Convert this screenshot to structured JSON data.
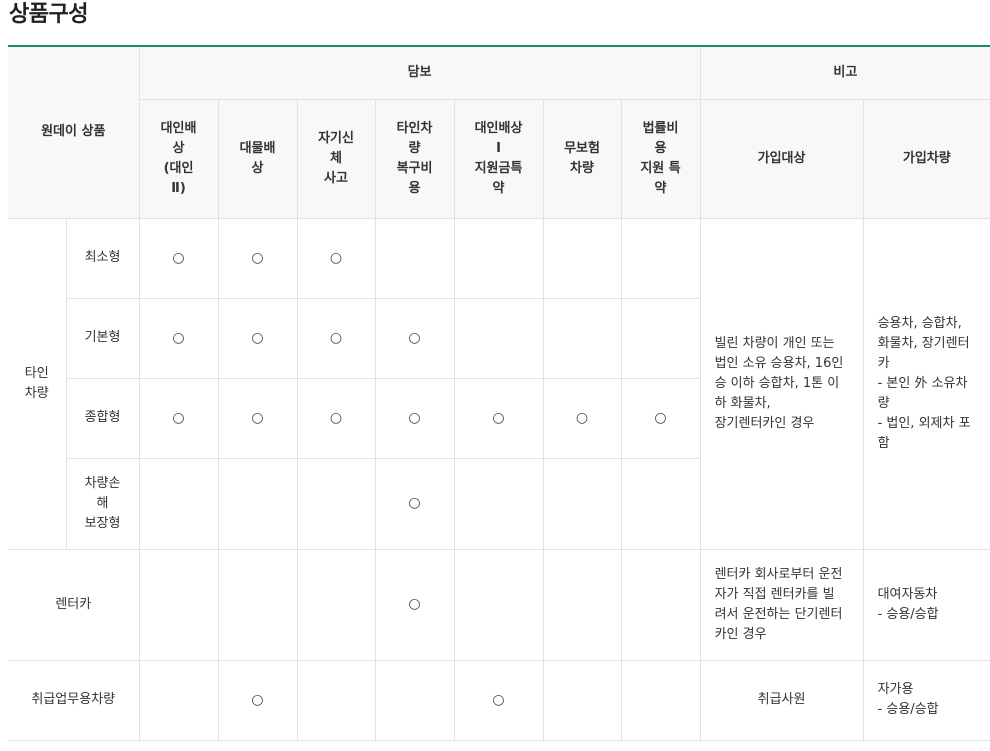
{
  "page": {
    "title": "상품구성"
  },
  "header": {
    "product_col": "원데이 상품",
    "coverage_group": "담보",
    "remarks_group": "비고",
    "coverage_items": [
      "대인배\n상\n(대인\nⅡ)",
      "대물배\n상",
      "자기신\n체\n사고",
      "타인차\n량\n복구비\n용",
      "대인배상\nⅠ\n지원금특\n약",
      "무보험\n차량",
      "법률비\n용\n지원 특\n약"
    ],
    "remark_items": [
      "가입대상",
      "가입차량"
    ]
  },
  "mark_symbol": "○",
  "groups": {
    "other_car": "타인\n차량"
  },
  "rows": {
    "minimum": {
      "label": "최소형"
    },
    "basic": {
      "label": "기본형"
    },
    "comprehensive": {
      "label": "종합형"
    },
    "damage": {
      "label": "차량손\n해\n보장형"
    },
    "rental": {
      "label": "렌터카",
      "target": "렌터카 회사로부터 운전\n자가 직접 렌터카를 빌\n려서 운전하는 단기렌터\n카인 경우",
      "vehicle": "대여자동차\n- 승용/승합"
    },
    "business": {
      "label": "취급업무용차량",
      "target": "취급사원",
      "vehicle": "자가용\n- 승용/승합"
    }
  },
  "other_car_remarks": {
    "target": "빌린 차량이 개인 또는\n법인 소유 승용차, 16인\n승 이하 승합차, 1톤 이\n하 화물차,\n장기렌터카인 경우",
    "vehicle": "승용차, 승합차,\n화물차, 장기렌터\n카\n- 본인 外 소유차\n량\n- 법인, 외제차 포\n함"
  }
}
